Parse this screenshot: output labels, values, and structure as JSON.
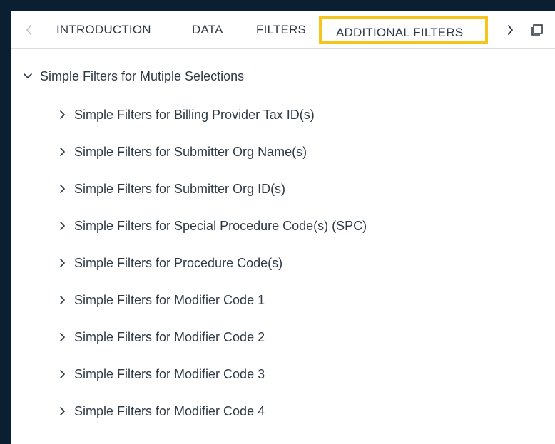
{
  "tabs": {
    "items": [
      {
        "key": "introduction",
        "label": "INTRODUCTION"
      },
      {
        "key": "data",
        "label": "DATA"
      },
      {
        "key": "filters",
        "label": "FILTERS"
      },
      {
        "key": "additional_filters",
        "label": "ADDITIONAL FILTERS",
        "selected": true
      }
    ]
  },
  "tree": {
    "root": {
      "label": "Simple Filters for Mutiple Selections",
      "expanded": true
    },
    "children": [
      {
        "label": "Simple Filters for Billing Provider Tax ID(s)"
      },
      {
        "label": "Simple Filters for Submitter Org Name(s)"
      },
      {
        "label": "Simple Filters for Submitter Org ID(s)"
      },
      {
        "label": "Simple Filters for Special Procedure Code(s) (SPC)"
      },
      {
        "label": "Simple Filters for Procedure Code(s)"
      },
      {
        "label": "Simple Filters for Modifier Code 1"
      },
      {
        "label": "Simple Filters for Modifier Code 2"
      },
      {
        "label": "Simple Filters for Modifier Code 3"
      },
      {
        "label": "Simple Filters for Modifier Code 4"
      }
    ]
  },
  "colors": {
    "page_background": "#0b1f33",
    "panel_background": "#ffffff",
    "selected_tab_border": "#f4c51b",
    "text": "#2f3a45",
    "muted": "#b9bec5",
    "divider": "#d9dde2"
  },
  "icons": {
    "prev": "chevron-left-icon",
    "next": "chevron-right-icon",
    "expand": "window-restore-icon",
    "root_toggle": "chevron-down-icon",
    "child_toggle": "chevron-right-icon"
  }
}
